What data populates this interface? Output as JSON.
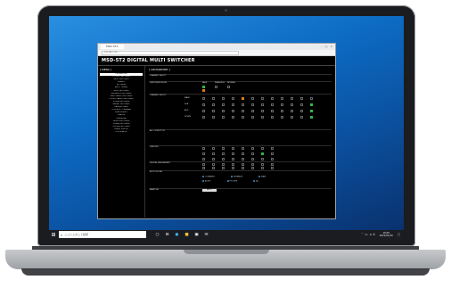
{
  "app": {
    "title": "MSD-5T2 DIGITAL MULTI SWITCHER",
    "tab_label": "MSD-5T2",
    "url": "192.168.1.126",
    "menu_header": "[ MENU ]",
    "menu_items": [
      "CROSSPOINT",
      "OUTPUT SETTINGS",
      "INPUT SETTINGS",
      "PRESET",
      "SETTINGS",
      "INPUT TIMING",
      "MULTI SETTINGS",
      "EDID/HDCP SETTINGS",
      "INPUT AUDIO SETTINGS",
      "OUTPUT AUDIO SETTINGS",
      "SOUND SETTINGS",
      "BRIGHT SETTINGS",
      "LAN SETTINGS",
      "CONTROL COMMAND",
      "USER PRESET",
      "STATUS",
      "LINK/BLINK",
      "DEVICE SETTINGS",
      "POWER SETTINGS",
      "SYSTEM SETTINGS",
      "EVENT STATUS",
      "LOG STATUS"
    ],
    "content_header": "[ CROSSPOINT ]",
    "sections": [
      "CHANNEL SELECT",
      "SWITCHING MODE",
      "CHANNEL SELECT",
      "ALL CH BUTTON",
      "LINK BUS",
      "SPECIAL ASSIGNMENT",
      "BUTTON LINK",
      "BANK SEL"
    ],
    "switching_labels": [
      "FADE",
      "SEAMLESS",
      "NORMAL"
    ],
    "row_labels": [
      "MAIN",
      "SUB",
      "AUX",
      "DOWN",
      "BANK",
      "LINK",
      "LINK"
    ],
    "button_link_options": [
      "COMBINED",
      "SEPARATE",
      "MAIN",
      "AUDIO",
      "PICTURE",
      "ALL"
    ],
    "apply_label": "APPLY"
  },
  "taskbar": {
    "search_placeholder": "ここに入力して検索",
    "time": "16:09",
    "date": "2021/01/29",
    "ime": "A"
  },
  "colors": {
    "accent_orange": "#e07a10",
    "accent_green": "#35b34a",
    "desktop_blue": "#0d6cc4"
  },
  "icons": [
    "windows-start-icon",
    "search-icon",
    "task-view-icon",
    "edge-icon",
    "file-explorer-icon",
    "store-icon",
    "mail-icon",
    "network-icon",
    "volume-icon",
    "notification-icon"
  ]
}
